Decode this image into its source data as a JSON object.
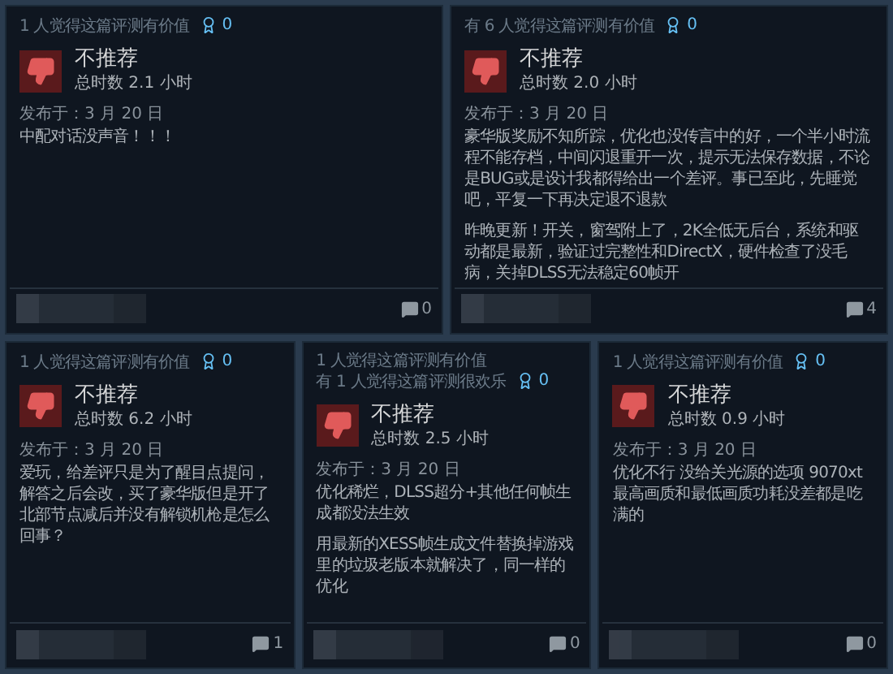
{
  "rows": [
    [
      {
        "helpful": [
          "1 人觉得这篇评测有价值"
        ],
        "awards": "0",
        "verdict": "不推荐",
        "hours": "总时数 2.1 小时",
        "posted": "发布于：3 月 20 日",
        "paragraphs": [
          "中配对话没声音！！！"
        ],
        "comments": "0"
      },
      {
        "helpful": [
          "有 6 人觉得这篇评测有价值"
        ],
        "awards": "0",
        "verdict": "不推荐",
        "hours": "总时数 2.0 小时",
        "posted": "发布于：3 月 20 日",
        "paragraphs": [
          "豪华版奖励不知所踪，优化也没传言中的好，一个半小时流程不能存档，中间闪退重开一次，提示无法保存数据，不论是BUG或是设计我都得给出一个差评。事已至此，先睡觉吧，平复一下再决定退不退款",
          "昨晚更新！开关，窗驾附上了，2K全低无后台，系统和驱动都是最新，验证过完整性和DirectX，硬件检查了没毛病，关掉DLSS无法稳定60帧开"
        ],
        "comments": "4"
      }
    ],
    [
      {
        "helpful": [
          "1 人觉得这篇评测有价值"
        ],
        "awards": "0",
        "verdict": "不推荐",
        "hours": "总时数 6.2 小时",
        "posted": "发布于：3 月 20 日",
        "paragraphs": [
          "爱玩，给差评只是为了醒目点提问，解答之后会改，买了豪华版但是开了北部节点减后并没有解锁机枪是怎么回事？"
        ],
        "comments": "1"
      },
      {
        "helpful": [
          "1 人觉得这篇评测有价值",
          "有 1 人觉得这篇评测很欢乐"
        ],
        "awards": "0",
        "verdict": "不推荐",
        "hours": "总时数 2.5 小时",
        "posted": "发布于：3 月 20 日",
        "paragraphs": [
          "优化稀烂，DLSS超分+其他任何帧生成都没法生效",
          "用最新的XESS帧生成文件替换掉游戏里的垃圾老版本就解决了，同一样的优化"
        ],
        "comments": "0"
      },
      {
        "helpful": [
          "1 人觉得这篇评测有价值"
        ],
        "awards": "0",
        "verdict": "不推荐",
        "hours": "总时数 0.9 小时",
        "posted": "发布于：3 月 20 日",
        "paragraphs": [
          "优化不行 没给关光源的选项 9070xt最高画质和最低画质功耗没差都是吃满的"
        ],
        "comments": "0"
      }
    ]
  ]
}
